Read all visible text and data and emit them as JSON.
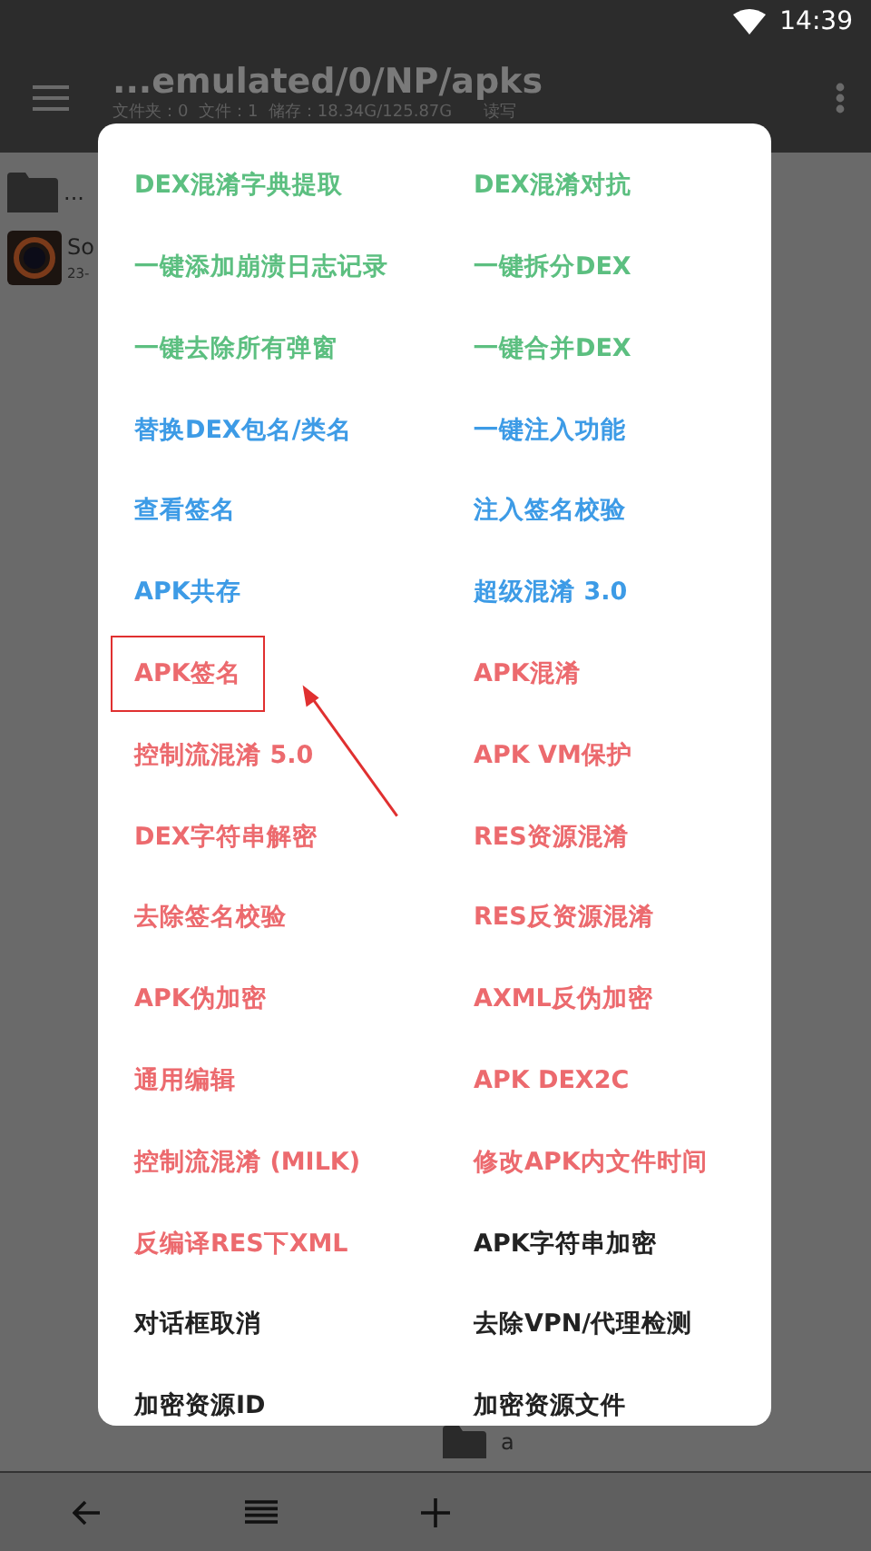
{
  "status_bar": {
    "time": "14:39"
  },
  "toolbar": {
    "title": "...emulated/0/NP/apks",
    "subtitle": "文件夹：0  文件：1  储存：18.34G/125.87G      读写"
  },
  "files": [
    {
      "kind": "folder",
      "name": "..."
    },
    {
      "kind": "app",
      "name": "So",
      "detail": "23-"
    }
  ],
  "bottom_file": {
    "name": "a"
  },
  "menu": [
    {
      "label": "DEX混淆字典提取",
      "color": "#5cbf80",
      "highlighted": false
    },
    {
      "label": "DEX混淆对抗",
      "color": "#5cbf80",
      "highlighted": false
    },
    {
      "label": "一键添加崩溃日志记录",
      "color": "#5cbf80",
      "highlighted": false
    },
    {
      "label": "一键拆分DEX",
      "color": "#5cbf80",
      "highlighted": false
    },
    {
      "label": "一键去除所有弹窗",
      "color": "#5cbf80",
      "highlighted": false
    },
    {
      "label": "一键合并DEX",
      "color": "#5cbf80",
      "highlighted": false
    },
    {
      "label": "替换DEX包名/类名",
      "color": "#3d9be6",
      "highlighted": false
    },
    {
      "label": "一键注入功能",
      "color": "#3d9be6",
      "highlighted": false
    },
    {
      "label": "查看签名",
      "color": "#3d9be6",
      "highlighted": false
    },
    {
      "label": "注入签名校验",
      "color": "#3d9be6",
      "highlighted": false
    },
    {
      "label": "APK共存",
      "color": "#3d9be6",
      "highlighted": false
    },
    {
      "label": "超级混淆 3.0",
      "color": "#3d9be6",
      "highlighted": false
    },
    {
      "label": "APK签名",
      "color": "#ec6a6e",
      "highlighted": true
    },
    {
      "label": "APK混淆",
      "color": "#ec6a6e",
      "highlighted": false
    },
    {
      "label": "控制流混淆 5.0",
      "color": "#ec6a6e",
      "highlighted": false
    },
    {
      "label": "APK VM保护",
      "color": "#ec6a6e",
      "highlighted": false
    },
    {
      "label": "DEX字符串解密",
      "color": "#ec6a6e",
      "highlighted": false
    },
    {
      "label": "RES资源混淆",
      "color": "#ec6a6e",
      "highlighted": false
    },
    {
      "label": "去除签名校验",
      "color": "#ec6a6e",
      "highlighted": false
    },
    {
      "label": "RES反资源混淆",
      "color": "#ec6a6e",
      "highlighted": false
    },
    {
      "label": "APK伪加密",
      "color": "#ec6a6e",
      "highlighted": false
    },
    {
      "label": "AXML反伪加密",
      "color": "#ec6a6e",
      "highlighted": false
    },
    {
      "label": "通用编辑",
      "color": "#ec6a6e",
      "highlighted": false
    },
    {
      "label": "APK DEX2C",
      "color": "#ec6a6e",
      "highlighted": false
    },
    {
      "label": "控制流混淆 (MILK)",
      "color": "#ec6a6e",
      "highlighted": false
    },
    {
      "label": "修改APK内文件时间",
      "color": "#ec6a6e",
      "highlighted": false
    },
    {
      "label": "反编译RES下XML",
      "color": "#ec6a6e",
      "highlighted": false
    },
    {
      "label": "APK字符串加密",
      "color": "#222222",
      "highlighted": false
    },
    {
      "label": "对话框取消",
      "color": "#222222",
      "highlighted": false
    },
    {
      "label": "去除VPN/代理检测",
      "color": "#222222",
      "highlighted": false
    },
    {
      "label": "加密资源ID",
      "color": "#222222",
      "highlighted": false
    },
    {
      "label": "加密资源文件",
      "color": "#222222",
      "highlighted": false
    }
  ],
  "bottom_bar": [
    {
      "kind": "back"
    },
    {
      "kind": "list"
    },
    {
      "kind": "add"
    }
  ]
}
